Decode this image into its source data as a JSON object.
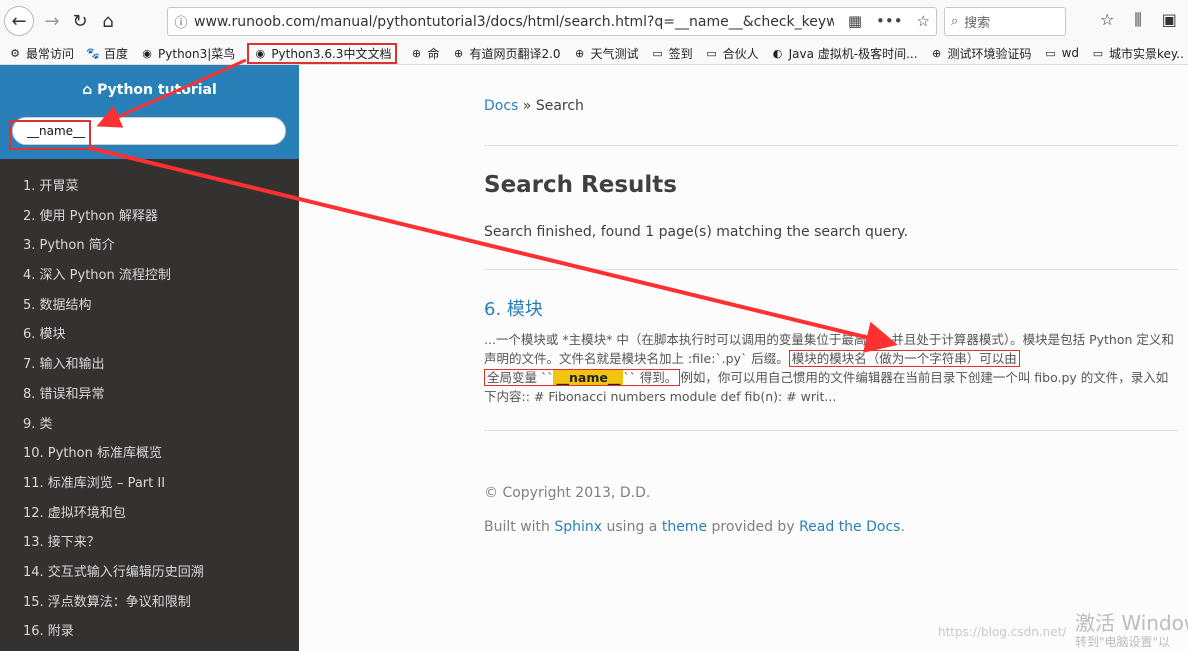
{
  "browser": {
    "url": "www.runoob.com/manual/pythontutorial3/docs/html/search.html?q=__name__&check_keywo",
    "search_placeholder": "搜索",
    "bookmarks": [
      {
        "label": "最常访问",
        "icon": "gear-icon"
      },
      {
        "label": "百度",
        "icon": "paw-icon"
      },
      {
        "label": "Python3|菜鸟",
        "icon": "runoob-icon"
      },
      {
        "label": "Python3.6.3中文文档",
        "icon": "runoob-icon",
        "highlighted": true
      },
      {
        "label": "命",
        "icon": "globe-icon"
      },
      {
        "label": "有道网页翻译2.0",
        "icon": "globe-icon"
      },
      {
        "label": "天气测试",
        "icon": "globe-icon"
      },
      {
        "label": "签到",
        "icon": "folder-icon"
      },
      {
        "label": "合伙人",
        "icon": "folder-icon"
      },
      {
        "label": "Java 虚拟机-极客时间...",
        "icon": "geek-icon"
      },
      {
        "label": "测试环境验证码",
        "icon": "globe-icon"
      },
      {
        "label": "wd",
        "icon": "folder-icon"
      },
      {
        "label": "城市实景key..",
        "icon": "folder-icon"
      }
    ]
  },
  "sidebar": {
    "title": "Python tutorial",
    "search_value": "__name__",
    "items": [
      "1. 开胃菜",
      "2. 使用 Python 解释器",
      "3. Python 简介",
      "4. 深入 Python 流程控制",
      "5. 数据结构",
      "6. 模块",
      "7. 输入和输出",
      "8. 错误和异常",
      "9. 类",
      "10. Python 标准库概览",
      "11. 标准库浏览 – Part II",
      "12. 虚拟环境和包",
      "13. 接下来？",
      "14. 交互式输入行编辑历史回溯",
      "15. 浮点数算法：争议和限制",
      "16. 附录"
    ]
  },
  "main": {
    "breadcrumb_docs": "Docs",
    "breadcrumb_sep": "»",
    "breadcrumb_current": "Search",
    "heading": "Search Results",
    "status": "Search finished, found 1 page(s) matching the search query.",
    "result_title": "6. 模块",
    "snippet_a": "...一个模块或 *主模块* 中（在脚本执行时可以调用的变量集位于最高级，并且处于计算器模式）。模块是包括 Python 定义和声明的文件。文件名就是模块名加上 :file:`.py` 后缀。",
    "snippet_box1": "模块的模块名（做为一个字符串）可以由",
    "snippet_box2_pre": "全局变量 ``",
    "snippet_highlight": "__name__",
    "snippet_box2_post": "`` 得到。",
    "snippet_b": "例如，你可以用自己惯用的文件编辑器在当前目录下创建一个叫 fibo.py 的文件，录入如下内容:: # Fibonacci numbers module def fib(n): # writ...",
    "copyright": "© Copyright 2013, D.D.",
    "built_with": "Built with",
    "sphinx": "Sphinx",
    "using_a": "using a",
    "theme": "theme",
    "provided_by": "provided by",
    "rtd": "Read the Docs",
    "period": "."
  },
  "overlay": {
    "watermark": "https://blog.csdn.net/",
    "win_activate": "激活 Windows",
    "win_activate_sub": "转到\"电脑设置\"以"
  },
  "colors": {
    "accent": "#2980b9",
    "sidebar_bg": "#343131",
    "annotation": "#e03030",
    "highlight": "#f1c40f"
  }
}
